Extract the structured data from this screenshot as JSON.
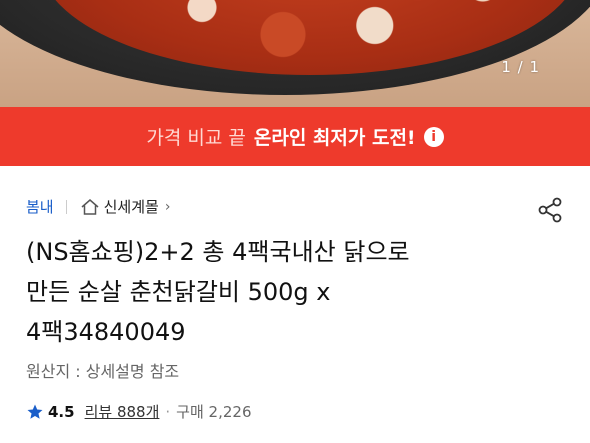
{
  "hero": {
    "image_label": "",
    "counter": "1 / 1"
  },
  "banner": {
    "prefix": "가격 비교 끝",
    "highlight": "온라인 최저가 도전!",
    "info_icon": "i",
    "bg_color": "#ee3a2c"
  },
  "breadcrumb": {
    "category": "봄내",
    "store": "신세계몰",
    "home_icon": "home-icon",
    "chevron": "›"
  },
  "product": {
    "title_line1": "(NS홈쇼핑)2+2 총 4팩국내산 닭으로",
    "title_line2": "만든 순살 춘천닭갈비 500g x",
    "title_line3": "4팩34840049",
    "origin": "원산지 : 상세설명 참조"
  },
  "rating": {
    "score": "4.5",
    "reviews": "리뷰 888개",
    "dot": "·",
    "sales": "구매 2,226",
    "star_color": "#1a5ec9"
  }
}
